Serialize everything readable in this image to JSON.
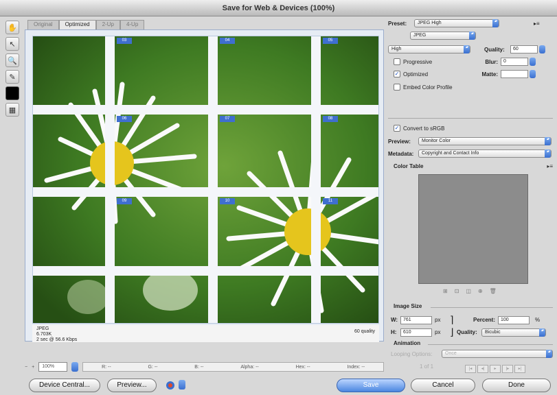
{
  "window": {
    "title": "Save for Web & Devices (100%)"
  },
  "tabs": [
    {
      "label": "Original"
    },
    {
      "label": "Optimized"
    },
    {
      "label": "2-Up"
    },
    {
      "label": "4-Up"
    }
  ],
  "toolbox": {
    "icons": [
      "hand-icon",
      "slice-select-icon",
      "zoom-icon",
      "eyedropper-icon",
      "eyedropper-color-swatch",
      "toggle-slices-icon"
    ]
  },
  "preview": {
    "slice_numbers": [
      "03",
      "04",
      "05",
      "06",
      "07",
      "08",
      "09",
      "10",
      "11"
    ],
    "info": {
      "format": "JPEG",
      "size": "6.703K",
      "time": "2 sec @ 56.6 Kbps",
      "quality": "60 quality"
    }
  },
  "status": {
    "zoom": "100%",
    "r_label": "R: --",
    "g_label": "G: --",
    "b_label": "B: --",
    "alpha_label": "Alpha: --",
    "hex_label": "Hex: --",
    "index_label": "Index: --"
  },
  "settings": {
    "preset_label": "Preset:",
    "preset_value": "JPEG High",
    "format_value": "JPEG",
    "compression_value": "High",
    "quality_label": "Quality:",
    "quality_value": "60",
    "progressive_label": "Progressive",
    "progressive_checked": false,
    "blur_label": "Blur:",
    "blur_value": "0",
    "optimized_label": "Optimized",
    "optimized_checked": true,
    "matte_label": "Matte:",
    "embed_label": "Embed Color Profile",
    "embed_checked": false,
    "convert_label": "Convert to sRGB",
    "convert_checked": true,
    "preview_label": "Preview:",
    "preview_value": "Monitor Color",
    "metadata_label": "Metadata:",
    "metadata_value": "Copyright and Contact Info",
    "color_table_label": "Color Table"
  },
  "image_size": {
    "section_label": "Image Size",
    "w_label": "W:",
    "w_value": "761",
    "w_unit": "px",
    "h_label": "H:",
    "h_value": "610",
    "h_unit": "px",
    "percent_label": "Percent:",
    "percent_value": "100",
    "percent_unit": "%",
    "quality_label": "Quality:",
    "quality_value": "Bicubic"
  },
  "animation": {
    "section_label": "Animation",
    "looping_label": "Looping Options:",
    "looping_value": "Once",
    "frame_label": "1 of 1"
  },
  "buttons": {
    "device_central": "Device Central...",
    "preview": "Preview...",
    "save": "Save",
    "cancel": "Cancel",
    "done": "Done"
  }
}
